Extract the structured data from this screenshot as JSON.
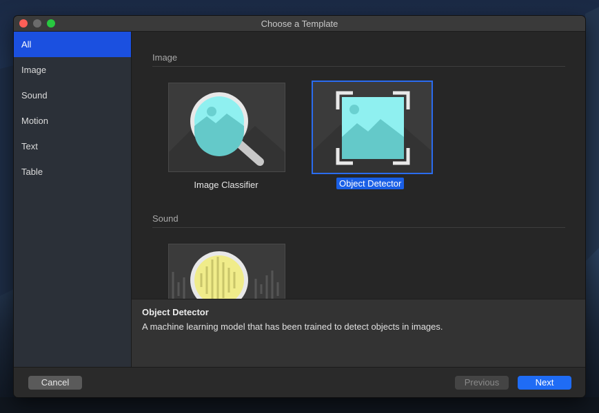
{
  "window": {
    "title": "Choose a Template"
  },
  "sidebar": {
    "items": [
      {
        "label": "All",
        "selected": true
      },
      {
        "label": "Image"
      },
      {
        "label": "Sound"
      },
      {
        "label": "Motion"
      },
      {
        "label": "Text"
      },
      {
        "label": "Table"
      }
    ]
  },
  "sections": [
    {
      "title": "Image",
      "templates": [
        {
          "label": "Image Classifier",
          "icon": "magnifier-image-icon"
        },
        {
          "label": "Object Detector",
          "icon": "object-detector-image-icon",
          "selected": true
        }
      ]
    },
    {
      "title": "Sound",
      "templates": [
        {
          "label": "",
          "icon": "magnifier-sound-wave-icon"
        }
      ]
    }
  ],
  "detail": {
    "title": "Object Detector",
    "description": "A machine learning model that has been trained to detect objects in images."
  },
  "footer": {
    "cancel_label": "Cancel",
    "previous_label": "Previous",
    "next_label": "Next"
  },
  "colors": {
    "accent": "#1f6cf5",
    "sidebar_selected": "#1b50e0",
    "image_teal": "#7de8e8",
    "sound_yellow": "#f0ec8a"
  }
}
